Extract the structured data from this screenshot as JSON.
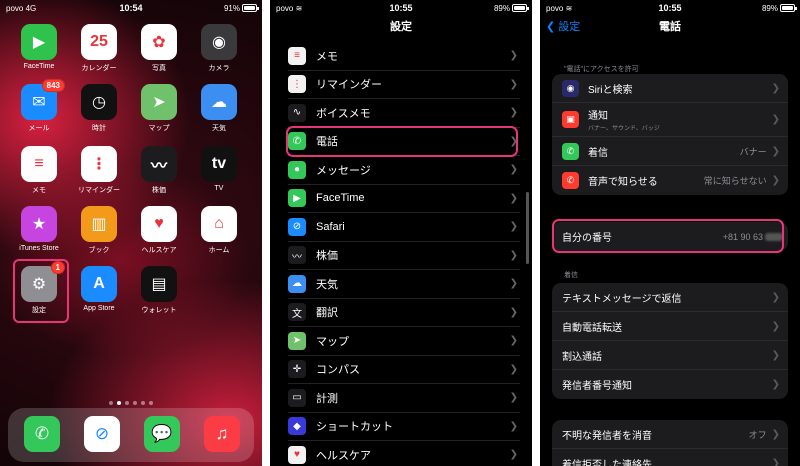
{
  "home": {
    "status": {
      "carrier": "povo",
      "network": "4G",
      "time": "10:54",
      "battery": "91%"
    },
    "apps": [
      {
        "label": "FaceTime",
        "icon": "facetime-icon",
        "color": "#2fc24c",
        "glyph": "▶"
      },
      {
        "label": "カレンダー",
        "icon": "calendar-icon",
        "color": "#ffffff",
        "glyph": "25",
        "day": "Friday"
      },
      {
        "label": "写真",
        "icon": "photos-icon",
        "color": "#ffffff",
        "glyph": "✿"
      },
      {
        "label": "カメラ",
        "icon": "camera-icon",
        "color": "#3a3a3c",
        "glyph": "◉"
      },
      {
        "label": "メール",
        "icon": "mail-icon",
        "color": "#1a8cff",
        "glyph": "✉",
        "badge": "843"
      },
      {
        "label": "時計",
        "icon": "clock-icon",
        "color": "#111111",
        "glyph": "◷"
      },
      {
        "label": "マップ",
        "icon": "maps-icon",
        "color": "#6fc26b",
        "glyph": "➤"
      },
      {
        "label": "天気",
        "icon": "weather-icon",
        "color": "#3c8ef0",
        "glyph": "☁"
      },
      {
        "label": "メモ",
        "icon": "notes-icon",
        "color": "#fdfdfd",
        "glyph": "≡"
      },
      {
        "label": "リマインダー",
        "icon": "reminders-icon",
        "color": "#ffffff",
        "glyph": "⋮"
      },
      {
        "label": "株価",
        "icon": "stocks-icon",
        "color": "#1c1c1e",
        "glyph": "〰"
      },
      {
        "label": "TV",
        "icon": "tv-icon",
        "color": "#111111",
        "glyph": "tv"
      },
      {
        "label": "iTunes Store",
        "icon": "itunes-store-icon",
        "color": "#c644e0",
        "glyph": "★"
      },
      {
        "label": "ブック",
        "icon": "books-icon",
        "color": "#f39a1b",
        "glyph": "▥"
      },
      {
        "label": "ヘルスケア",
        "icon": "health-icon",
        "color": "#ffffff",
        "glyph": "♥"
      },
      {
        "label": "ホーム",
        "icon": "home-icon",
        "color": "#ffffff",
        "glyph": "⌂"
      },
      {
        "label": "設定",
        "icon": "settings-icon",
        "color": "#8e8e93",
        "glyph": "⚙",
        "badge": "1"
      },
      {
        "label": "App Store",
        "icon": "app-store-icon",
        "color": "#1a8cff",
        "glyph": "A"
      },
      {
        "label": "ウォレット",
        "icon": "wallet-icon",
        "color": "#111111",
        "glyph": "▤"
      }
    ],
    "dock": [
      {
        "label": "",
        "icon": "phone-icon",
        "color": "#34c759",
        "glyph": "✆"
      },
      {
        "label": "",
        "icon": "safari-icon",
        "color": "#ffffff",
        "glyph": "⊘"
      },
      {
        "label": "",
        "icon": "messages-icon",
        "color": "#34c759",
        "glyph": "💬"
      },
      {
        "label": "",
        "icon": "music-icon",
        "color": "#fc3c44",
        "glyph": "♫"
      }
    ]
  },
  "settings": {
    "status": {
      "carrier": "povo",
      "time": "10:55",
      "battery": "89%"
    },
    "title": "設定",
    "rows": [
      {
        "label": "メモ",
        "icon": "notes-icon",
        "color": "#f2f2f2",
        "glyph": "≡"
      },
      {
        "label": "リマインダー",
        "icon": "reminders-icon",
        "color": "#f2f2f2",
        "glyph": "⋮"
      },
      {
        "label": "ボイスメモ",
        "icon": "voice-memos-icon",
        "color": "#1c1c1e",
        "glyph": "∿"
      },
      {
        "label": "電話",
        "icon": "phone-icon",
        "color": "#34c759",
        "glyph": "✆"
      },
      {
        "label": "メッセージ",
        "icon": "messages-icon",
        "color": "#34c759",
        "glyph": "●"
      },
      {
        "label": "FaceTime",
        "icon": "facetime-icon",
        "color": "#34c759",
        "glyph": "▶"
      },
      {
        "label": "Safari",
        "icon": "safari-icon",
        "color": "#1a8cff",
        "glyph": "⊘"
      },
      {
        "label": "株価",
        "icon": "stocks-icon",
        "color": "#1c1c1e",
        "glyph": "〰"
      },
      {
        "label": "天気",
        "icon": "weather-icon",
        "color": "#3c8ef0",
        "glyph": "☁"
      },
      {
        "label": "翻訳",
        "icon": "translate-icon",
        "color": "#1c1c1e",
        "glyph": "文"
      },
      {
        "label": "マップ",
        "icon": "maps-icon",
        "color": "#6fc26b",
        "glyph": "➤"
      },
      {
        "label": "コンパス",
        "icon": "compass-icon",
        "color": "#1c1c1e",
        "glyph": "✛"
      },
      {
        "label": "計測",
        "icon": "measure-icon",
        "color": "#1c1c1e",
        "glyph": "▭"
      },
      {
        "label": "ショートカット",
        "icon": "shortcuts-icon",
        "color": "#3a3adb",
        "glyph": "◆"
      },
      {
        "label": "ヘルスケア",
        "icon": "health-icon",
        "color": "#f2f2f2",
        "glyph": "♥"
      }
    ]
  },
  "phone": {
    "status": {
      "carrier": "povo",
      "time": "10:55",
      "battery": "89%"
    },
    "back_label": "設定",
    "title": "電話",
    "access_header": "\"電話\"にアクセスを許可",
    "access_rows": [
      {
        "label": "Siriと検索",
        "sub": "",
        "value": "",
        "icon": "siri-icon",
        "color": "#2a2a6a",
        "glyph": "◉"
      },
      {
        "label": "通知",
        "sub": "バナー、サウンド、バッジ",
        "value": "",
        "icon": "notifications-icon",
        "color": "#ff3b30",
        "glyph": "▣"
      },
      {
        "label": "着信",
        "sub": "",
        "value": "バナー",
        "icon": "incoming-call-icon",
        "color": "#34c759",
        "glyph": "✆"
      },
      {
        "label": "音声で知らせる",
        "sub": "",
        "value": "常に知らせない",
        "icon": "announce-calls-icon",
        "color": "#ff3b30",
        "glyph": "✆"
      }
    ],
    "my_number": {
      "label": "自分の番号",
      "value": "+81 90 63"
    },
    "calls_header": "着信",
    "call_rows": [
      {
        "label": "テキストメッセージで返信",
        "value": ""
      },
      {
        "label": "自動電話転送",
        "value": ""
      },
      {
        "label": "割込通話",
        "value": ""
      },
      {
        "label": "発信者番号通知",
        "value": ""
      }
    ],
    "bottom_rows": [
      {
        "label": "不明な発信者を消音",
        "value": "オフ"
      },
      {
        "label": "着信拒否した連絡先",
        "value": ""
      }
    ]
  },
  "colors": {
    "highlight": "#e8357a",
    "accent_blue": "#0a84ff",
    "group_bg": "#1c1c1e"
  }
}
